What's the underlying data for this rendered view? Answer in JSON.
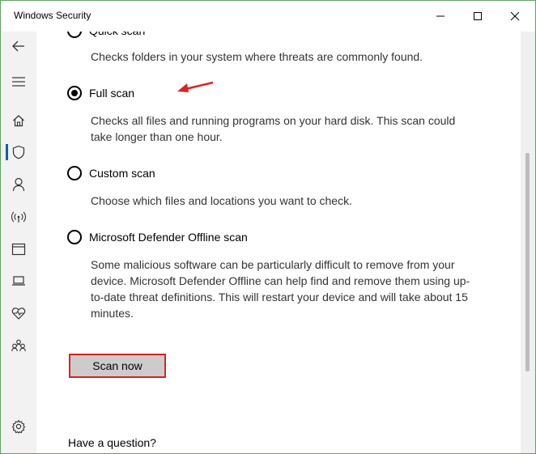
{
  "window": {
    "title": "Windows Security"
  },
  "sidebar": {
    "items": [
      {
        "icon": "back-arrow-icon"
      },
      {
        "icon": "hamburger-menu-icon"
      },
      {
        "icon": "home-icon"
      },
      {
        "icon": "shield-icon",
        "selected": true
      },
      {
        "icon": "person-icon"
      },
      {
        "icon": "wireless-icon"
      },
      {
        "icon": "browser-window-icon"
      },
      {
        "icon": "laptop-icon"
      },
      {
        "icon": "heart-pulse-icon"
      },
      {
        "icon": "family-icon"
      },
      {
        "icon": "gear-icon"
      }
    ]
  },
  "scan_options": [
    {
      "label": "Quick scan",
      "checked": false,
      "description": "Checks folders in your system where threats are commonly found."
    },
    {
      "label": "Full scan",
      "checked": true,
      "description": "Checks all files and running programs on your hard disk. This scan could take longer than one hour."
    },
    {
      "label": "Custom scan",
      "checked": false,
      "description": "Choose which files and locations you want to check."
    },
    {
      "label": "Microsoft Defender Offline scan",
      "checked": false,
      "description": "Some malicious software can be particularly difficult to remove from your device. Microsoft Defender Offline can help find and remove them using up-to-date threat definitions. This will restart your device and will take about 15 minutes."
    }
  ],
  "actions": {
    "scan_now_label": "Scan now"
  },
  "help": {
    "question": "Have a question?"
  },
  "colors": {
    "annotation": "#e02020",
    "accent": "#0063b1"
  }
}
